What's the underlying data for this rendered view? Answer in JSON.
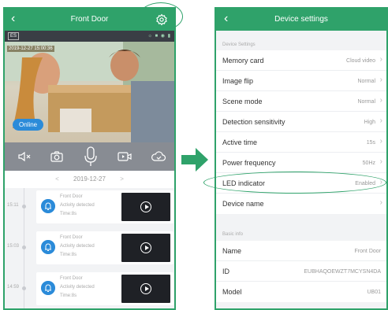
{
  "left": {
    "header": {
      "title": "Front Door"
    },
    "status": {
      "camera_id": "ES"
    },
    "video": {
      "timestamp": "2019-12-27  15:00:36",
      "online_label": "Online"
    },
    "date_nav": {
      "date": "2019-12-27",
      "prev": "<",
      "next": ">"
    },
    "events": [
      {
        "time": "15:11",
        "name": "Front Door",
        "detail": "Activity detected",
        "duration": "Time:8s"
      },
      {
        "time": "15:03",
        "name": "Front Door",
        "detail": "Activity detected",
        "duration": "Time:8s"
      },
      {
        "time": "14:59",
        "name": "Front Door",
        "detail": "Activity detected",
        "duration": "Time:8s"
      }
    ],
    "icons": [
      "back-icon",
      "gear-icon",
      "mute-icon",
      "camera-icon",
      "mic-icon",
      "record-icon",
      "cloud-icon",
      "play-icon",
      "bell-icon"
    ]
  },
  "right": {
    "header": {
      "title": "Device settings"
    },
    "settings_section": "Device Settings",
    "settings": [
      {
        "label": "Memory card",
        "value": "Cloud video"
      },
      {
        "label": "Image flip",
        "value": "Normal"
      },
      {
        "label": "Scene mode",
        "value": "Normal"
      },
      {
        "label": "Detection sensitivity",
        "value": "High"
      },
      {
        "label": "Active time",
        "value": "15s"
      },
      {
        "label": "Power frequency",
        "value": "50Hz"
      },
      {
        "label": "LED indicator",
        "value": "Enabled"
      },
      {
        "label": "Device name",
        "value": ""
      }
    ],
    "basic_section": "Basic info",
    "basic": [
      {
        "label": "Name",
        "value": "Front Door"
      },
      {
        "label": "ID",
        "value": "EUBHAQOEWZT7MCYSN4DA"
      },
      {
        "label": "Model",
        "value": "UB01"
      }
    ]
  },
  "colors": {
    "accent": "#2fa26a",
    "online": "#2b8bd9",
    "controls_bg": "#888c93"
  }
}
